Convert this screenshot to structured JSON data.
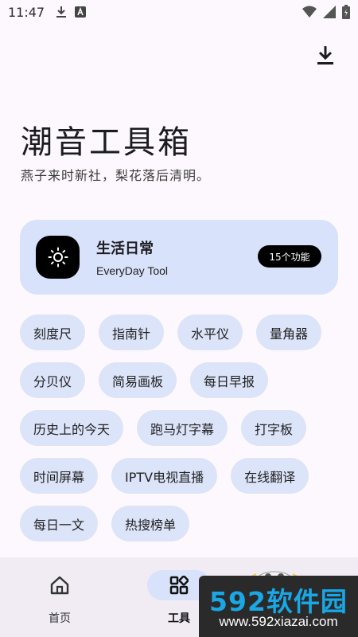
{
  "status_bar": {
    "time": "11:47",
    "icons": [
      "download-icon",
      "a-badge-icon",
      "wifi-icon",
      "signal-icon",
      "battery-icon"
    ]
  },
  "header": {
    "title": "潮音工具箱",
    "subtitle": "燕子来时新社，梨花落后清明。",
    "action_icon": "download-icon"
  },
  "category": {
    "title": "生活日常",
    "subtitle": "EveryDay Tool",
    "count": "15个功能",
    "icon": "sun-icon"
  },
  "tools": [
    [
      "刻度尺",
      "指南针",
      "水平仪",
      "量角器"
    ],
    [
      "分贝仪",
      "简易画板",
      "每日早报"
    ],
    [
      "历史上的今天",
      "跑马灯字幕",
      "打字板"
    ],
    [
      "时间屏幕",
      "IPTV电视直播",
      "在线翻译"
    ],
    [
      "每日一文",
      "热搜榜单"
    ]
  ],
  "nav": {
    "home": {
      "label": "首页",
      "icon": "home-icon"
    },
    "tools": {
      "label": "工具",
      "icon": "grid-icon"
    }
  },
  "watermark": {
    "logo": "592软件园",
    "url": "www.592xiazai.com"
  },
  "colors": {
    "background": "#fdf8fd",
    "card": "#d8e2fb",
    "chip": "#dce4f9",
    "nav_bg": "#f1ecf4",
    "badge": "#000000"
  }
}
